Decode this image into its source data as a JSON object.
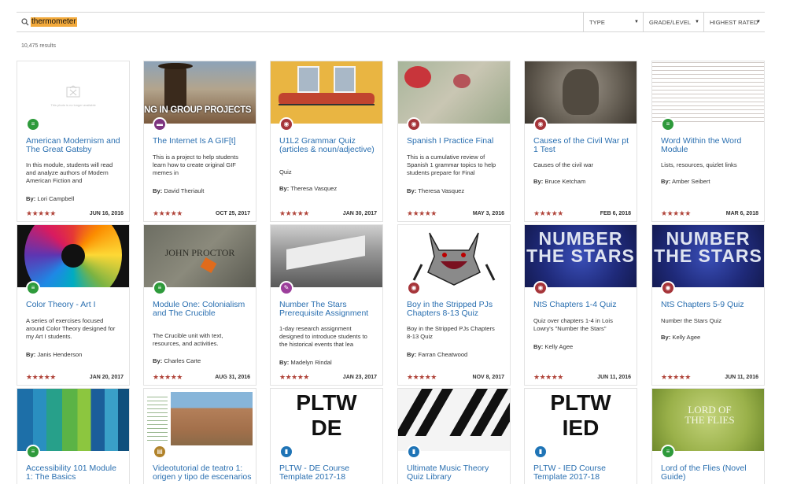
{
  "search": {
    "query": "thermometer"
  },
  "filters": {
    "type": "TYPE",
    "grade": "GRADE/LEVEL",
    "sort": "HIGHEST RATED"
  },
  "results_count": "10,475 results",
  "missing_image_text": "This photo is no longer available",
  "stars": "★★★★★",
  "author_prefix": "By:",
  "cards": [
    {
      "title": "American Modernism and The Great Gatsby",
      "desc": "In this module, students will read and analyze authors of Modern American Fiction and",
      "author": "Lori Campbell",
      "date": "JUN 16, 2016",
      "type": "module"
    },
    {
      "title": "The Internet Is A GIF[t]",
      "desc": "This is a project to help students learn how to create original GIF memes in",
      "author": "David Theriault",
      "date": "OCT 25, 2017",
      "type": "project",
      "thumb_text": "NG IN GROUP PROJECTS"
    },
    {
      "title": "U1L2 Grammar Quiz (articles & noun/adjective)",
      "desc": "Quiz",
      "author": "Theresa Vasquez",
      "date": "JAN 30, 2017",
      "type": "quiz"
    },
    {
      "title": "Spanish I Practice Final",
      "desc": "This is a cumulative review of Spanish 1 grammar topics to help students prepare for Final",
      "author": "Theresa Vasquez",
      "date": "MAY 3, 2016",
      "type": "quiz"
    },
    {
      "title": "Causes of the Civil War pt 1 Test",
      "desc": "Causes of the civil war",
      "author": "Bruce Ketcham",
      "date": "FEB 6, 2018",
      "type": "quiz"
    },
    {
      "title": "Word Within the Word Module",
      "desc": "Lists, resources, quizlet links",
      "author": "Amber Seibert",
      "date": "MAR 6, 2018",
      "type": "module"
    },
    {
      "title": "Color Theory - Art I",
      "desc": "A series of exercises focused around Color Theory designed for my Art I students.",
      "author": "Janis Henderson",
      "date": "JAN 20, 2017",
      "type": "module"
    },
    {
      "title": "Module One: Colonialism and The Crucible",
      "desc": "The Crucible unit with text, resources, and activities.",
      "author": "Charles Carte",
      "date": "AUG 31, 2016",
      "type": "module",
      "thumb_text": "JOHN PROCTOR"
    },
    {
      "title": "Number The Stars Prerequisite Assignment",
      "desc": "1-day research assignment designed to introduce students to the historical events that lea",
      "author": "Madelyn Rindal",
      "date": "JAN 23, 2017",
      "type": "assign"
    },
    {
      "title": "Boy in the Stripped PJs Chapters 8-13 Quiz",
      "desc": "Boy in the Stripped PJs Chapters 8-13 Quiz",
      "author": "Farran Cheatwood",
      "date": "NOV 8, 2017",
      "type": "quiz"
    },
    {
      "title": "NtS Chapters 1-4 Quiz",
      "desc": "Quiz over chapters 1-4 in Lois Lowry's \"Number the Stars\"",
      "author": "Kelly Agee",
      "date": "JUN 11, 2016",
      "type": "quiz",
      "thumb_text": "NUMBER THE STARS"
    },
    {
      "title": "NtS Chapters 5-9 Quiz",
      "desc": "Number the Stars Quiz",
      "author": "Kelly Agee",
      "date": "JUN 11, 2016",
      "type": "quiz",
      "thumb_text": "NUMBER THE STARS"
    },
    {
      "title": "Accessibility 101 Module 1: The Basics",
      "type": "module"
    },
    {
      "title": "Videotutorial de teatro 1: origen y tipo de escenarios",
      "type": "unit"
    },
    {
      "title": "PLTW - DE Course Template 2017-18",
      "type": "course",
      "thumb_text": "PLTW DE"
    },
    {
      "title": "Ultimate Music Theory Quiz Library",
      "type": "course"
    },
    {
      "title": "PLTW - IED Course Template 2017-18",
      "type": "course",
      "thumb_text": "PLTW IED"
    },
    {
      "title": "Lord of the Flies (Novel Guide)",
      "type": "module",
      "thumb_text": "LORD OF THE FLIES"
    }
  ]
}
